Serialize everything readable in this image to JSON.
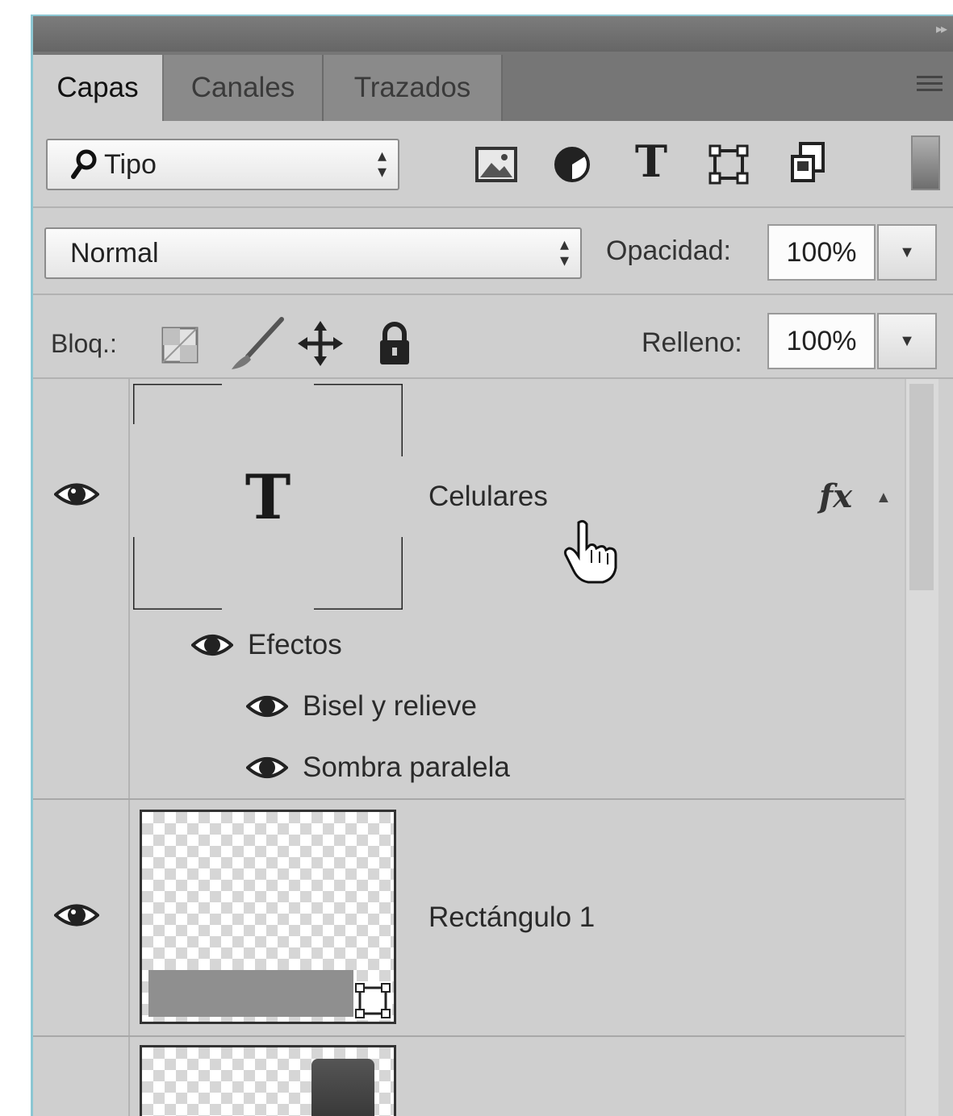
{
  "tabs": [
    {
      "label": "Capas",
      "active": true
    },
    {
      "label": "Canales",
      "active": false
    },
    {
      "label": "Trazados",
      "active": false
    }
  ],
  "filter": {
    "selected": "Tipo",
    "icons": [
      "image-filter-icon",
      "adjustment-filter-icon",
      "type-filter-icon",
      "shape-filter-icon",
      "smart-object-filter-icon"
    ],
    "type_icon_glyph": "T"
  },
  "blend": {
    "mode": "Normal",
    "opacity_label": "Opacidad:",
    "opacity_value": "100%"
  },
  "lock": {
    "label": "Bloq.:",
    "fill_label": "Relleno:",
    "fill_value": "100%"
  },
  "layers": [
    {
      "name": "Celulares",
      "kind": "text",
      "visible": true,
      "thumb_glyph": "T",
      "fx_label": "fx",
      "effects_label": "Efectos",
      "effects": [
        "Bisel y relieve",
        "Sombra paralela"
      ]
    },
    {
      "name": "Rectángulo 1",
      "kind": "shape",
      "visible": true
    },
    {
      "name": "",
      "kind": "smart-object",
      "visible": false
    }
  ],
  "colors": {
    "panel_bg": "#cfcfcf",
    "tab_bar": "#767676",
    "panel_edge": "#8cc6d2"
  }
}
